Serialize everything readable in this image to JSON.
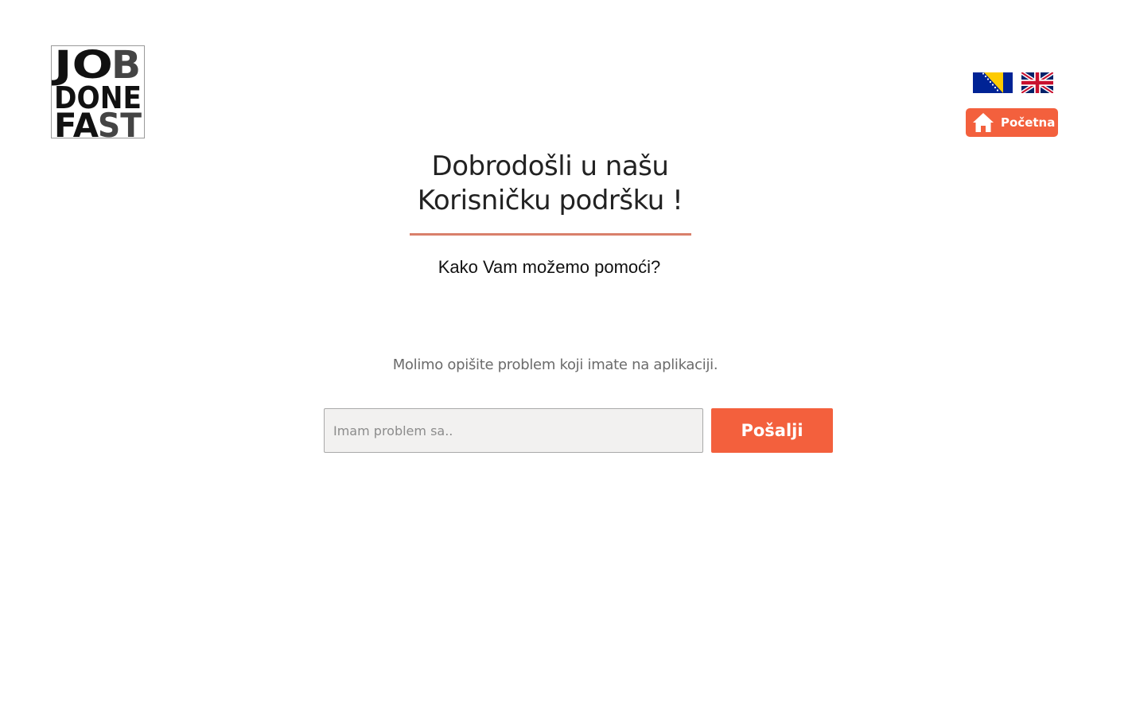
{
  "brand": {
    "logo_icon": "job-done-fast-logo",
    "logo_lines": [
      "JOB",
      "DONE",
      "FAST"
    ]
  },
  "header": {
    "languages": [
      {
        "code": "bs",
        "icon": "bosnia-flag-icon"
      },
      {
        "code": "en",
        "icon": "uk-flag-icon"
      }
    ],
    "home_button": {
      "label": "Početna",
      "icon": "home-icon"
    }
  },
  "main": {
    "title_line1": "Dobrodošli u našu",
    "title_line2": "Korisničku podršku !",
    "subtitle": "Kako Vam možemo pomoći?",
    "instructions": "Molimo opišite problem koji imate na aplikaciji.",
    "form": {
      "input_value": "",
      "input_placeholder": "Imam problem sa..",
      "submit_label": "Pošalji"
    }
  },
  "colors": {
    "accent": "#f3603d",
    "divider": "#d9806b",
    "input_bg": "#f2f1f0"
  }
}
